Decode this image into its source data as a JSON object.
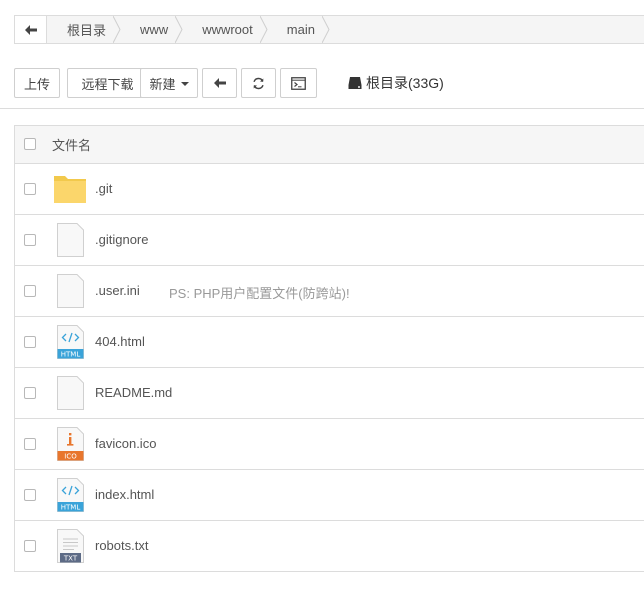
{
  "breadcrumb": {
    "items": [
      {
        "label": "根目录"
      },
      {
        "label": "www"
      },
      {
        "label": "wwwroot"
      },
      {
        "label": "main"
      }
    ]
  },
  "toolbar": {
    "upload_label": "上传",
    "remote_download_label": "远程下载",
    "new_label": "新建",
    "disk_label": "根目录(33G)"
  },
  "table": {
    "header_name": "文件名",
    "rows": [
      {
        "name": ".git",
        "type": "folder",
        "note": ""
      },
      {
        "name": ".gitignore",
        "type": "file",
        "note": ""
      },
      {
        "name": ".user.ini",
        "type": "file",
        "note": "PS: PHP用户配置文件(防跨站)!"
      },
      {
        "name": "404.html",
        "type": "html",
        "badge": "HTML",
        "note": ""
      },
      {
        "name": "README.md",
        "type": "file",
        "note": ""
      },
      {
        "name": "favicon.ico",
        "type": "ico",
        "badge": "ICO",
        "note": ""
      },
      {
        "name": "index.html",
        "type": "html",
        "badge": "HTML",
        "note": ""
      },
      {
        "name": "robots.txt",
        "type": "txt",
        "badge": "TXT",
        "note": ""
      }
    ]
  },
  "colors": {
    "folder": "#fbd66b",
    "html_badge": "#3aa3d9",
    "ico_badge": "#e8762d",
    "txt_badge": "#5d6b86",
    "border": "#dcdcdc"
  }
}
